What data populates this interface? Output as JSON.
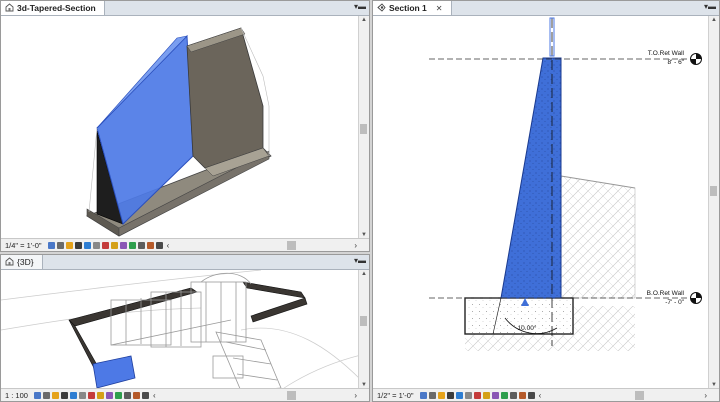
{
  "views": {
    "tapered": {
      "title": "3d-Tapered-Section",
      "scale": "1/4\" = 1'-0\""
    },
    "threed": {
      "title": "{3D}",
      "scale": "1 : 100"
    },
    "section": {
      "title": "Section 1",
      "scale": "1/2\" = 1'-0\"",
      "close_label": "✕"
    }
  },
  "section_view": {
    "top_level": {
      "name": "T.O.Ret Wall",
      "elevation": "8' - 6\""
    },
    "bottom_level": {
      "name": "B.O.Ret Wall",
      "elevation": "-7' - 0\""
    },
    "dimension": "10.00°"
  },
  "icons": {
    "view_tab": "house-3d-icon",
    "section_tab": "section-view-icon",
    "pane_menu": "pane-menu-icon",
    "level_head": "level-marker-icon",
    "view_controls": [
      "scale-icon",
      "detail-level-icon",
      "visual-style-icon",
      "sun-path-icon",
      "shadows-icon",
      "render-icon",
      "crop-icon",
      "show-crop-icon",
      "unlock-3d-icon",
      "temporary-hide-icon",
      "reveal-hidden-icon",
      "analysis-display-icon",
      "highlight-icon",
      "constraints-icon"
    ]
  },
  "colors": {
    "wall_blue": "#4d79e6",
    "wall_dark": "#2b2b2b",
    "section_fill": "#3f6fd8",
    "tab_bg": "#dde3ea"
  }
}
